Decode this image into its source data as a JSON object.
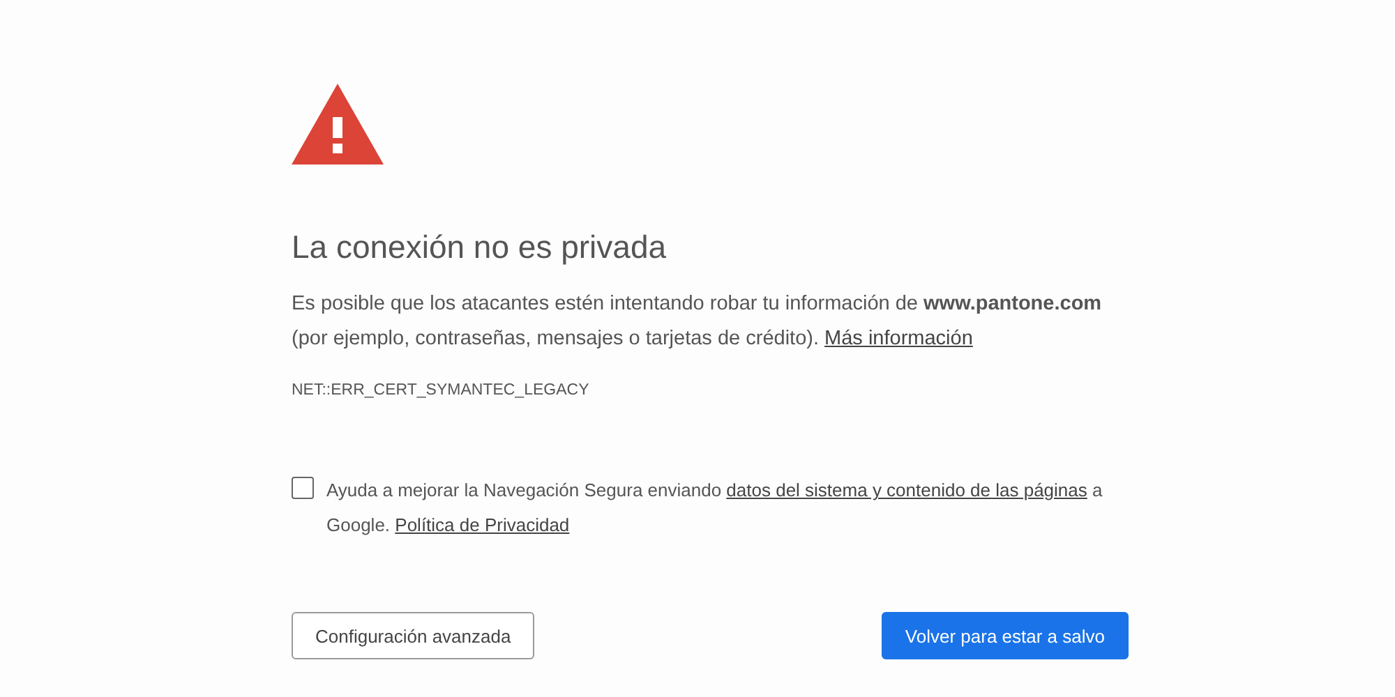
{
  "heading": "La conexión no es privada",
  "message": [
    {
      "kind": "text",
      "text": "Es posible que los atacantes estén intentando robar tu información de **www.pantone.com** (por ejemplo, contraseñas, mensajes o tarjetas de crédito). "
    },
    {
      "kind": "link",
      "text": "Más información"
    }
  ],
  "error_code": "NET::ERR_CERT_SYMANTEC_LEGACY",
  "opt_in": {
    "checked": false,
    "parts": [
      {
        "kind": "text",
        "text": "Ayuda a mejorar la Navegación Segura enviando "
      },
      {
        "kind": "link",
        "text": "datos del sistema y contenido de las páginas"
      },
      {
        "kind": "text",
        "text": " a Google. "
      },
      {
        "kind": "link",
        "text": "Política de Privacidad"
      }
    ]
  },
  "buttons": [
    {
      "kind": "secondary",
      "label": "Configuración avanzada"
    },
    {
      "kind": "primary",
      "label": "Volver para estar a salvo"
    }
  ]
}
